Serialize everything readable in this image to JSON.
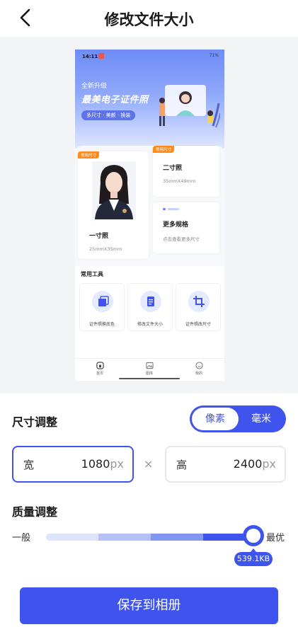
{
  "header": {
    "title": "修改文件大小"
  },
  "preview": {
    "status": {
      "time": "14:11",
      "right": "71%"
    },
    "banner": {
      "upgrade": "全新升级",
      "headline": "最美电子证件照",
      "tagline": "多尺寸 · 美颜 · 换装"
    },
    "cards": [
      {
        "tag": "常用尺寸",
        "title": "一寸照",
        "size": "25mmX35mm"
      },
      {
        "tag": "常用尺寸",
        "title": "二寸照",
        "size": "35mmX49mm"
      },
      {
        "tag": "",
        "title": "更多规格",
        "size": "点击查看更多尺寸"
      }
    ],
    "tools_title": "常用工具",
    "tools": [
      {
        "label": "证件照换底色",
        "icon": "copy-layers-icon"
      },
      {
        "label": "修改文件大小",
        "icon": "document-icon"
      },
      {
        "label": "证件照改尺寸",
        "icon": "crop-icon"
      }
    ],
    "tabs": [
      {
        "label": "首页",
        "icon": "home-icon"
      },
      {
        "label": "图库",
        "icon": "gallery-icon"
      },
      {
        "label": "我的",
        "icon": "profile-icon"
      }
    ]
  },
  "size_section": {
    "label": "尺寸调整",
    "unit_toggle": {
      "selected": "像素",
      "other": "毫米"
    },
    "width": {
      "label": "宽",
      "value": "1080",
      "unit": "px"
    },
    "height": {
      "label": "高",
      "value": "2400",
      "unit": "px"
    },
    "separator": "×"
  },
  "quality_section": {
    "label": "质量调整",
    "low_label": "一般",
    "high_label": "最优",
    "level_fraction": 1.0,
    "file_size": "539.1KB"
  },
  "save_button": "保存到相册",
  "colors": {
    "accent": "#3e54ec",
    "tag_orange": "#ff8c1a",
    "preview_bg": "#f3f4f6"
  }
}
